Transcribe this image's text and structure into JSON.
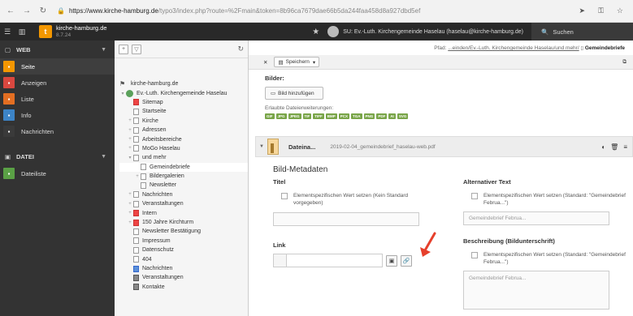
{
  "browser": {
    "url_host": "https://www.kirche-hamburg.de",
    "url_path": "/typo3/index.php?route=%2Fmain&token=8b96ca7679dae66b5da244faa458d8a927dbd5ef"
  },
  "topbar": {
    "site_name": "kirche-hamburg.de",
    "version": "8.7.24",
    "user": "SU: Ev.-Luth. Kirchengemeinde Haselau (haselau@kirche-hamburg.de)",
    "search_label": "Suchen"
  },
  "modules": {
    "web_group": "WEB",
    "web_items": [
      {
        "label": "Seite",
        "icon": "page-module-icon",
        "color": "#f49700"
      },
      {
        "label": "Anzeigen",
        "icon": "view-module-icon",
        "color": "#d9473f"
      },
      {
        "label": "Liste",
        "icon": "list-module-icon",
        "color": "#e36e22"
      },
      {
        "label": "Info",
        "icon": "info-module-icon",
        "color": "#3c84c7"
      },
      {
        "label": "Nachrichten",
        "icon": "news-module-icon",
        "color": "#3a3a3a"
      }
    ],
    "file_group": "DATEI",
    "file_items": [
      {
        "label": "Dateiliste",
        "icon": "filelist-module-icon",
        "color": "#5aa045"
      }
    ]
  },
  "tree": {
    "root": "kirche-hamburg.de",
    "parish": "Ev.-Luth. Kirchengemeinde Haselau",
    "nodes": [
      {
        "label": "Sitemap",
        "indent": 2,
        "type": "red"
      },
      {
        "label": "Startseite",
        "indent": 2,
        "type": "page"
      },
      {
        "label": "Kirche",
        "indent": 2,
        "type": "page",
        "exp": "+"
      },
      {
        "label": "Adressen",
        "indent": 2,
        "type": "page",
        "exp": "+"
      },
      {
        "label": "Arbeitsbereiche",
        "indent": 2,
        "type": "page",
        "exp": "+"
      },
      {
        "label": "MoGo Haselau",
        "indent": 2,
        "type": "page",
        "exp": "+"
      },
      {
        "label": "und mehr",
        "indent": 2,
        "type": "page",
        "exp": "-"
      },
      {
        "label": "Gemeindebriefe",
        "indent": 3,
        "type": "page",
        "selected": true
      },
      {
        "label": "Bildergalerien",
        "indent": 3,
        "type": "page",
        "exp": "+"
      },
      {
        "label": "Newsletter",
        "indent": 3,
        "type": "page"
      },
      {
        "label": "Nachrichten",
        "indent": 2,
        "type": "page",
        "exp": "+"
      },
      {
        "label": "Veranstaltungen",
        "indent": 2,
        "type": "page",
        "exp": "+"
      },
      {
        "label": "Intern",
        "indent": 2,
        "type": "red",
        "exp": "+"
      },
      {
        "label": "150 Jahre Kirchturm",
        "indent": 2,
        "type": "red",
        "exp": "+"
      },
      {
        "label": "Newsletter Bestätigung",
        "indent": 2,
        "type": "page"
      },
      {
        "label": "Impressum",
        "indent": 2,
        "type": "page"
      },
      {
        "label": "Datenschutz",
        "indent": 2,
        "type": "page"
      },
      {
        "label": "404",
        "indent": 2,
        "type": "page"
      },
      {
        "label": "Nachrichten",
        "indent": 2,
        "type": "blue"
      },
      {
        "label": "Veranstaltungen",
        "indent": 2,
        "type": "dark"
      },
      {
        "label": "Kontakte",
        "indent": 2,
        "type": "dark"
      }
    ]
  },
  "content": {
    "path_label": "Pfad:",
    "path_value": "...einden/Ev.-Luth. Kirchengemeinde Haselau/und mehr/",
    "path_current": "Gemeindebriefe",
    "save_label": "Speichern",
    "images_label": "Bilder:",
    "add_image": "Bild hinzufügen",
    "allowed_ext_label": "Erlaubte Dateierweiterungen:",
    "extensions": [
      "GIF",
      "JPG",
      "JPEG",
      "TIF",
      "TIFF",
      "BMP",
      "PCX",
      "TGA",
      "PNG",
      "PDF",
      "AI",
      "SVG"
    ],
    "file_title": "Dateina...",
    "file_name": "2019-02-04_gemeindebrief_haselau-web.pdf",
    "meta_title": "Bild-Metadaten",
    "title_label": "Titel",
    "title_checkbox": "Elementspezifischen Wert setzen (Kein Standard vorgegeben)",
    "alt_label": "Alternativer Text",
    "alt_checkbox": "Elementspezifischen Wert setzen (Standard: \"Gemeindebrief Februa...\")",
    "alt_placeholder": "Gemeindebrief Februa...",
    "link_label": "Link",
    "desc_label": "Beschreibung (Bildunterschrift)",
    "desc_checkbox": "Elementspezifischen Wert setzen (Standard: \"Gemeindebrief Februa...\")",
    "desc_placeholder": "Gemeindebrief Februa..."
  }
}
